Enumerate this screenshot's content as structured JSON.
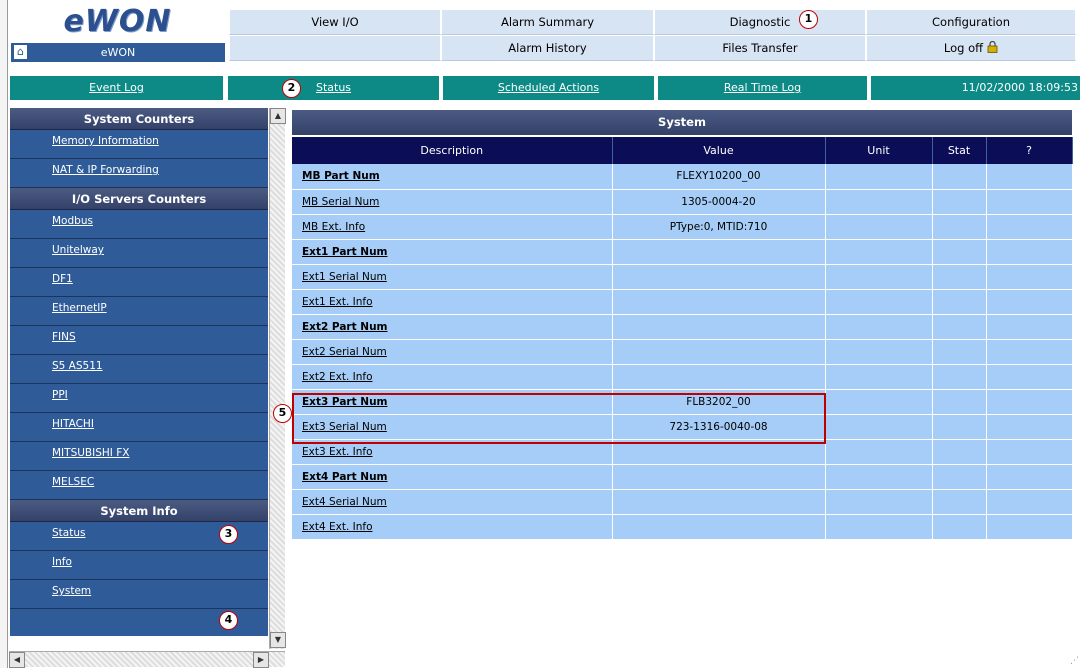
{
  "logo": {
    "text": "eWON"
  },
  "home_bar": {
    "label": "eWON"
  },
  "top_nav": {
    "row1": [
      "View I/O",
      "Alarm Summary",
      "Diagnostic",
      "Configuration"
    ],
    "row2": [
      "",
      "Alarm History",
      "Files Transfer",
      "Log off"
    ],
    "logoff_icon": "lock-icon"
  },
  "sub_nav": {
    "items": [
      "Event Log",
      "Status",
      "Scheduled Actions",
      "Real Time Log"
    ],
    "datetime": "11/02/2000 18:09:53"
  },
  "sidebar": {
    "sections": [
      {
        "title": "System Counters",
        "items": [
          "Memory Information",
          "NAT & IP Forwarding"
        ]
      },
      {
        "title": "I/O Servers Counters",
        "items": [
          "Modbus",
          "Unitelway",
          "DF1",
          "EthernetIP",
          "FINS",
          "S5 AS511",
          "PPI",
          "HITACHI",
          "MITSUBISHI FX",
          "MELSEC"
        ]
      },
      {
        "title": "System Info",
        "items": [
          "Status",
          "Info",
          "System"
        ]
      }
    ]
  },
  "main": {
    "title": "System",
    "columns": [
      "Description",
      "Value",
      "Unit",
      "Stat",
      "?"
    ],
    "rows": [
      {
        "desc": "MB Part Num",
        "value": "FLEXY10200_00",
        "bold": true
      },
      {
        "desc": "MB Serial Num",
        "value": "1305-0004-20",
        "bold": false
      },
      {
        "desc": "MB Ext. Info",
        "value": "PType:0, MTID:710",
        "bold": false
      },
      {
        "desc": "Ext1 Part Num",
        "value": "",
        "bold": true
      },
      {
        "desc": "Ext1 Serial Num",
        "value": "",
        "bold": false
      },
      {
        "desc": "Ext1 Ext. Info",
        "value": "",
        "bold": false
      },
      {
        "desc": "Ext2 Part Num",
        "value": "",
        "bold": true
      },
      {
        "desc": "Ext2 Serial Num",
        "value": "",
        "bold": false
      },
      {
        "desc": "Ext2 Ext. Info",
        "value": "",
        "bold": false
      },
      {
        "desc": "Ext3 Part Num",
        "value": "FLB3202_00",
        "bold": true
      },
      {
        "desc": "Ext3 Serial Num",
        "value": "723-1316-0040-08",
        "bold": false
      },
      {
        "desc": "Ext3 Ext. Info",
        "value": "",
        "bold": false
      },
      {
        "desc": "Ext4 Part Num",
        "value": "",
        "bold": true
      },
      {
        "desc": "Ext4 Serial Num",
        "value": "",
        "bold": false
      },
      {
        "desc": "Ext4 Ext. Info",
        "value": "",
        "bold": false
      }
    ]
  },
  "callouts": [
    "1",
    "2",
    "3",
    "4",
    "5"
  ],
  "colors": {
    "nav_bg": "#d7e4f3",
    "teal": "#0e8a86",
    "sidebar": "#2f5c98",
    "header_dark": "#0b0d57",
    "row_bg": "#a6cdf7",
    "callout_red": "#c00000"
  }
}
